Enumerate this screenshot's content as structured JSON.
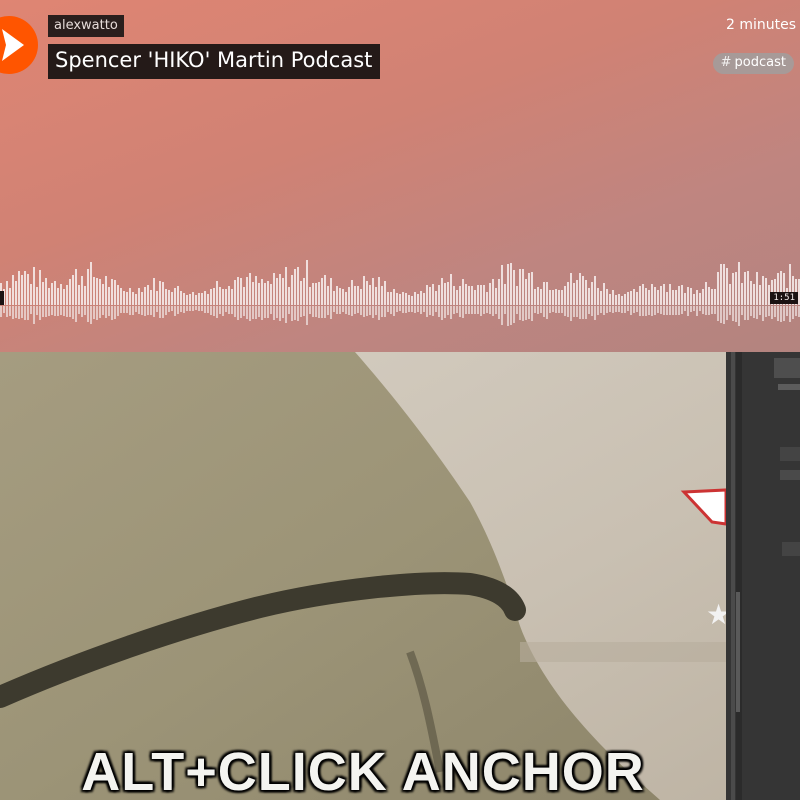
{
  "player": {
    "username": "alexwatto",
    "title": "Spencer 'HIKO' Martin Podcast",
    "posted": "2 minutes",
    "tag": "podcast",
    "tag_hash": "#",
    "duration": "1:51",
    "progress": 0,
    "accent_color": "#ff5500"
  },
  "artwork": {
    "caption": "ALT+CLICK ANCHOR"
  },
  "icons": {
    "play": "play-icon"
  }
}
